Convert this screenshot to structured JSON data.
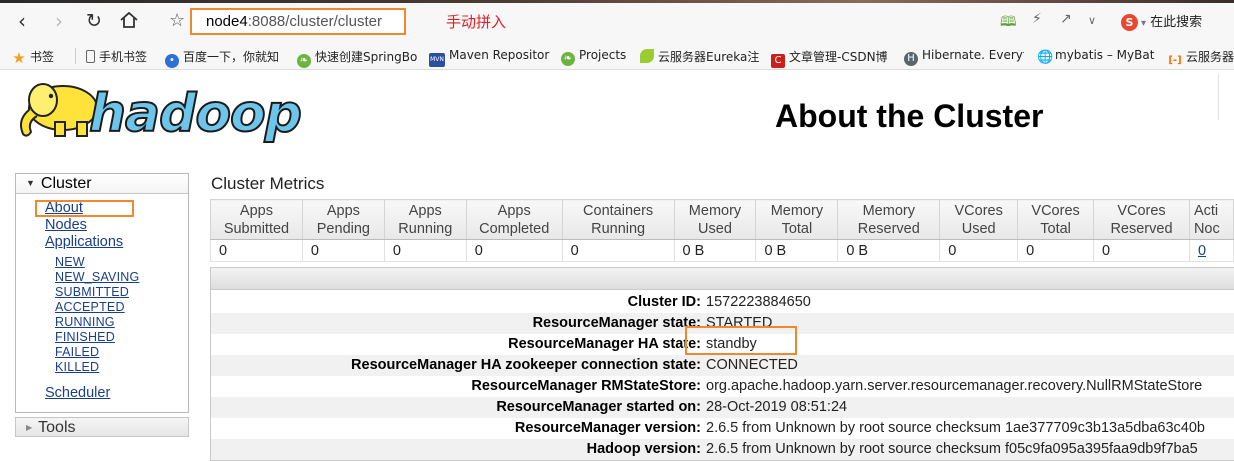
{
  "browser": {
    "url_host": "node4",
    "url_rest": ":8088/cluster/cluster",
    "annotation": "手动拼入",
    "search_label": "在此搜索"
  },
  "bookmarks": [
    {
      "label": "书签",
      "icon": "star-icon",
      "color": "#f0a020"
    },
    {
      "label": "手机书签",
      "icon": "phone-icon",
      "color": "#888888"
    },
    {
      "label": "百度一下，你就知",
      "icon": "baidu-paw-icon",
      "color": "#2f6fd8"
    },
    {
      "label": "快速创建SpringBo",
      "icon": "spring-leaf-icon",
      "color": "#6cb33f"
    },
    {
      "label": "Maven Repositor",
      "icon": "mvn-icon",
      "color": "#2a4fa0"
    },
    {
      "label": "Projects",
      "icon": "spring-leaf-icon",
      "color": "#6cb33f"
    },
    {
      "label": "云服务器Eureka注",
      "icon": "leaf-icon",
      "color": "#9acd32"
    },
    {
      "label": "文章管理-CSDN博",
      "icon": "csdn-icon",
      "color": "#c8201a"
    },
    {
      "label": "Hibernate. Everyt",
      "icon": "hibernate-icon",
      "color": "#59666c"
    },
    {
      "label": "mybatis – MyBat",
      "icon": "globe-icon",
      "color": "#666666"
    },
    {
      "label": "云服务器",
      "icon": "aliyun-icon",
      "color": "#ff6a00"
    }
  ],
  "page": {
    "logo_text": "hadoop",
    "title": "About the Cluster"
  },
  "sidebar": {
    "cluster_label": "Cluster",
    "links": [
      "About",
      "Nodes",
      "Applications"
    ],
    "app_states": [
      "NEW",
      "NEW_SAVING",
      "SUBMITTED",
      "ACCEPTED",
      "RUNNING",
      "FINISHED",
      "FAILED",
      "KILLED"
    ],
    "scheduler_label": "Scheduler",
    "tools_label": "Tools"
  },
  "metrics": {
    "title": "Cluster Metrics",
    "headers": [
      [
        "Apps",
        "Submitted"
      ],
      [
        "Apps",
        "Pending"
      ],
      [
        "Apps",
        "Running"
      ],
      [
        "Apps",
        "Completed"
      ],
      [
        "Containers",
        "Running"
      ],
      [
        "Memory",
        "Used"
      ],
      [
        "Memory",
        "Total"
      ],
      [
        "Memory",
        "Reserved"
      ],
      [
        "VCores",
        "Used"
      ],
      [
        "VCores",
        "Total"
      ],
      [
        "VCores",
        "Reserved"
      ],
      [
        "Acti",
        "Noc"
      ]
    ],
    "values": [
      "0",
      "0",
      "0",
      "0",
      "0",
      "0 B",
      "0 B",
      "0 B",
      "0",
      "0",
      "0",
      "0"
    ]
  },
  "cluster_info": [
    {
      "key": "Cluster ID:",
      "value": "1572223884650"
    },
    {
      "key": "ResourceManager state:",
      "value": "STARTED"
    },
    {
      "key": "ResourceManager HA state:",
      "value": "standby"
    },
    {
      "key": "ResourceManager HA zookeeper connection state:",
      "value": "CONNECTED"
    },
    {
      "key": "ResourceManager RMStateStore:",
      "value": "org.apache.hadoop.yarn.server.resourcemanager.recovery.NullRMStateStore"
    },
    {
      "key": "ResourceManager started on:",
      "value": "28-Oct-2019 08:51:24"
    },
    {
      "key": "ResourceManager version:",
      "value": "2.6.5 from Unknown by root source checksum 1ae377709c3b13a5dba63c40b"
    },
    {
      "key": "Hadoop version:",
      "value": "2.6.5 from Unknown by root source checksum f05c9fa095a395faa9db9f7ba5"
    }
  ]
}
